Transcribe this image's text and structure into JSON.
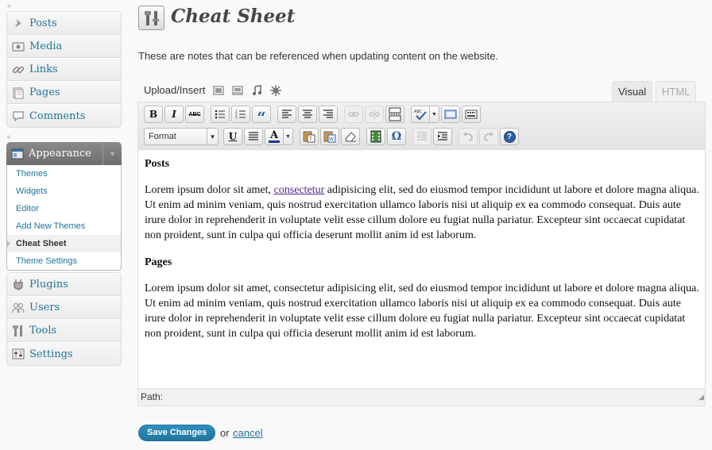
{
  "sidebar": {
    "top_items": [
      {
        "label": "Posts",
        "icon": "pushpin-icon"
      },
      {
        "label": "Media",
        "icon": "media-icon"
      },
      {
        "label": "Links",
        "icon": "link-icon"
      },
      {
        "label": "Pages",
        "icon": "pages-icon"
      },
      {
        "label": "Comments",
        "icon": "comments-icon"
      }
    ],
    "appearance": {
      "label": "Appearance",
      "submenu": [
        "Themes",
        "Widgets",
        "Editor",
        "Add New Themes",
        "Cheat Sheet",
        "Theme Settings"
      ],
      "current": "Cheat Sheet"
    },
    "bottom_items": [
      {
        "label": "Plugins",
        "icon": "plugins-icon"
      },
      {
        "label": "Users",
        "icon": "users-icon"
      },
      {
        "label": "Tools",
        "icon": "tools-icon"
      },
      {
        "label": "Settings",
        "icon": "settings-icon"
      }
    ],
    "separator_glyph": "«"
  },
  "page": {
    "title": "Cheat Sheet",
    "description": "These are notes that can be referenced when updating content on the website."
  },
  "media_bar": {
    "label": "Upload/Insert",
    "icons": [
      "add-image-icon",
      "add-video-icon",
      "add-audio-icon",
      "add-media-icon"
    ]
  },
  "editor": {
    "tabs": {
      "visual": "Visual",
      "html": "HTML"
    },
    "format_select": "Format",
    "toolbar_row1": [
      "bold",
      "italic",
      "strikethrough",
      "bullet-list",
      "numbered-list",
      "blockquote",
      "align-left",
      "align-center",
      "align-right",
      "insert-link",
      "unlink",
      "insert-more",
      "spellcheck",
      "fullscreen",
      "kitchen-sink"
    ],
    "toolbar_row2": [
      "format",
      "underline",
      "justify",
      "text-color",
      "paste-text",
      "paste-word",
      "clear-formatting",
      "insert-media",
      "special-character",
      "outdent",
      "indent",
      "undo",
      "redo",
      "help"
    ],
    "bold_glyph": "B",
    "italic_glyph": "I",
    "strike_glyph": "ABC",
    "underline_glyph": "U",
    "color_glyph": "A",
    "omega_glyph": "Ω",
    "help_glyph": "?",
    "quote_glyph": "“",
    "path_label": "Path:",
    "content": {
      "heading1": "Posts",
      "p1_before_link": "Lorem ipsum dolor sit amet, ",
      "p1_link": "consectetur",
      "p1_after_link": " adipisicing elit, sed do eiusmod tempor incididunt ut labore et dolore magna aliqua. Ut enim ad minim veniam, quis nostrud exercitation ullamco laboris nisi ut aliquip ex ea commodo consequat. Duis aute irure dolor in reprehenderit in voluptate velit esse cillum dolore eu fugiat nulla pariatur. Excepteur sint occaecat cupidatat non proident, sunt in culpa qui officia deserunt mollit anim id est laborum.",
      "heading2": "Pages",
      "p2": "Lorem ipsum dolor sit amet, consectetur adipisicing elit, sed do eiusmod tempor incididunt ut labore et dolore magna aliqua. Ut enim ad minim veniam, quis nostrud exercitation ullamco laboris nisi ut aliquip ex ea commodo consequat. Duis aute irure dolor in reprehenderit in voluptate velit esse cillum dolore eu fugiat nulla pariatur. Excepteur sint occaecat cupidatat non proident, sunt in culpa qui officia deserunt mollit anim id est laborum."
    }
  },
  "actions": {
    "save": "Save Changes",
    "or": "or",
    "cancel": "cancel"
  },
  "colors": {
    "link": "#21759b",
    "visited_link": "#551a8b",
    "appearance_header": "#7a7a7a"
  }
}
